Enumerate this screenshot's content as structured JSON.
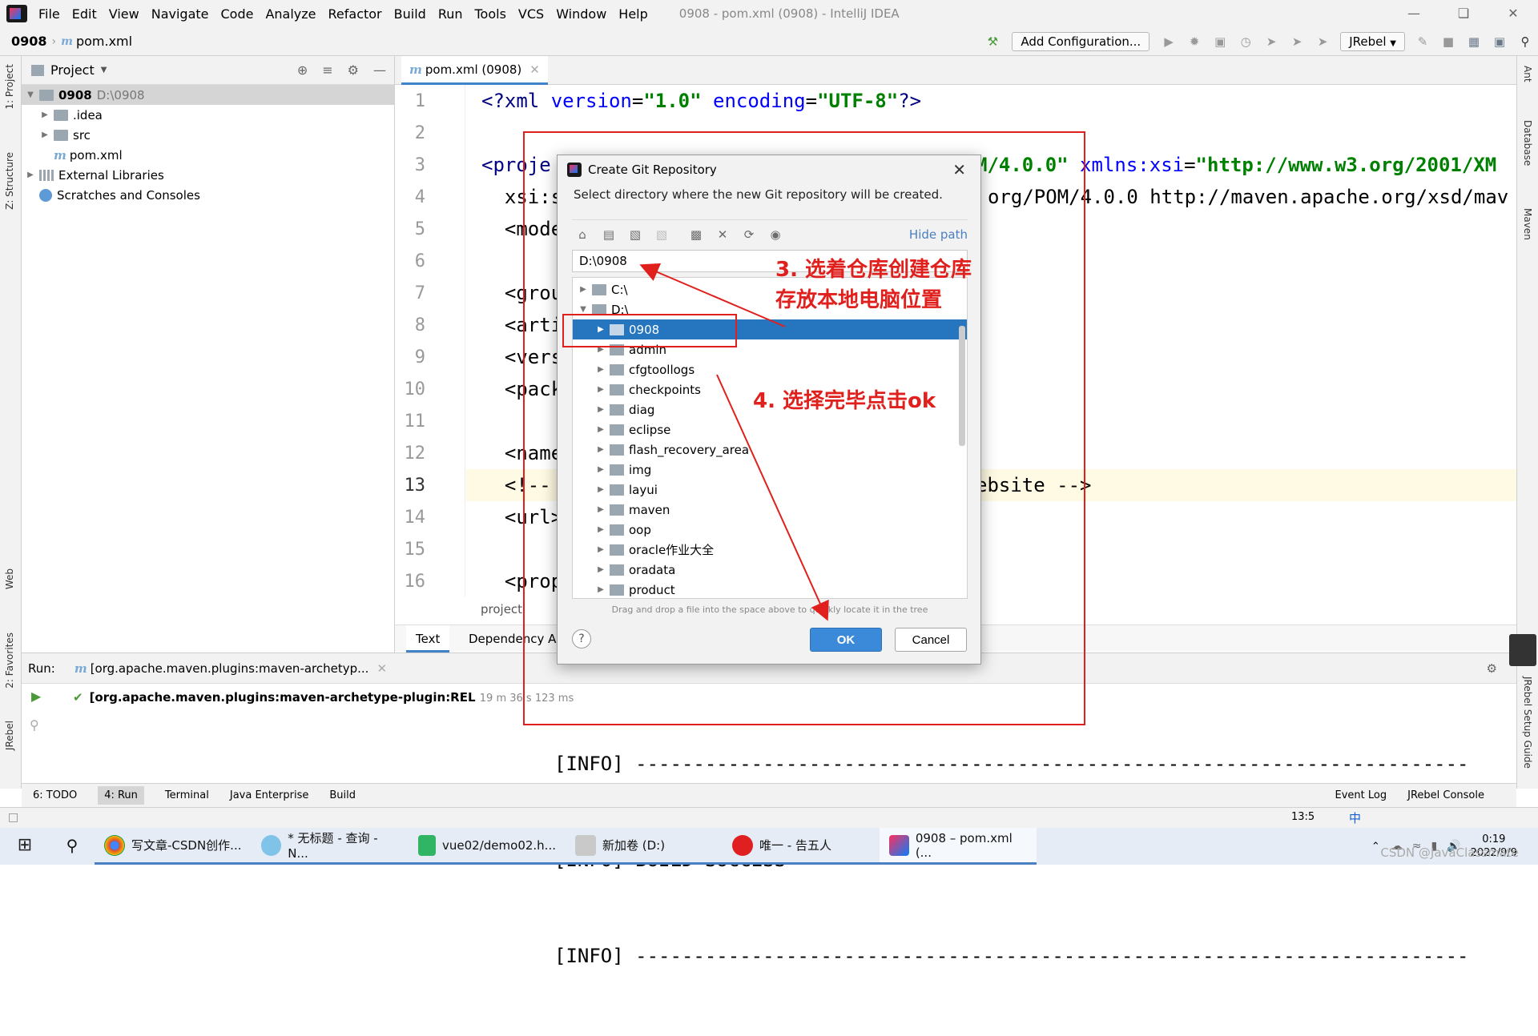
{
  "window": {
    "title": "0908 - pom.xml (0908) - IntelliJ IDEA",
    "menu": [
      "File",
      "Edit",
      "View",
      "Navigate",
      "Code",
      "Analyze",
      "Refactor",
      "Build",
      "Run",
      "Tools",
      "VCS",
      "Window",
      "Help"
    ]
  },
  "navbar": {
    "project": "0908",
    "file": "pom.xml",
    "add_configuration": "Add Configuration...",
    "jrebel": "JRebel"
  },
  "left_strip": {
    "project": "1: Project",
    "structure": "Z: Structure",
    "web": "Web",
    "favorites": "2: Favorites",
    "jrebel": "JRebel"
  },
  "right_strip": {
    "ant": "Ant",
    "database": "Database",
    "maven": "Maven",
    "jrebel_guide": "JRebel Setup Guide"
  },
  "project_panel": {
    "title": "Project",
    "root_name": "0908",
    "root_path": "D:\\0908",
    "items": [
      ".idea",
      "src",
      "pom.xml"
    ],
    "external_libraries": "External Libraries",
    "scratches": "Scratches and Consoles"
  },
  "editor": {
    "tab": "pom.xml (0908)",
    "line_numbers": [
      "1",
      "2",
      "3",
      "4",
      "5",
      "6",
      "7",
      "8",
      "9",
      "10",
      "11",
      "12",
      "13",
      "14",
      "15",
      "16"
    ],
    "bottom_tabs": [
      "Text",
      "Dependency A"
    ],
    "breadcrumb": "project",
    "code": {
      "l1_a": "<?xml ",
      "l1_b": "version",
      "l1_c": "=",
      "l1_d": "\"1.0\"",
      "l1_e": " encoding",
      "l1_f": "=",
      "l1_g": "\"UTF-8\"",
      "l1_h": "?>",
      "l3_a": "<proje",
      "l3_b": "M/4.0.0\"",
      "l3_c": " xmlns:xsi",
      "l3_d": "=",
      "l3_e": "\"http://www.w3.org/2001/XM",
      "l4_a": "  xsi:s",
      "l4_b": "org/POM/4.0.0 http://maven.apache.org/xsd/mav",
      "l5": "  <mode",
      "l7": "  <grou",
      "l8": "  <arti",
      "l9": "  <vers",
      "l10": "  <pack",
      "l12": "  <name",
      "l13_a": "  <!--",
      "l13_b": "ebsite -->",
      "l14": "  <url>",
      "l16": "  <prop"
    }
  },
  "run_panel": {
    "label": "Run:",
    "tab": "[org.apache.maven.plugins:maven-archetyp...",
    "item": "[org.apache.maven.plugins:maven-archetype-plugin:REL",
    "time": "19 m 36 s 123 ms",
    "console": [
      "[INFO] ------------------------------------------------------------------------",
      "[INFO] BUILD SUCCESS",
      "[INFO] ------------------------------------------------------------------------"
    ]
  },
  "bottom_tools": [
    "6: TODO",
    "4: Run",
    "Terminal",
    "Java Enterprise",
    "Build"
  ],
  "bottom_right_tools": [
    "Event Log",
    "JRebel Console"
  ],
  "status": {
    "position": "13:5"
  },
  "dialog": {
    "title": "Create Git Repository",
    "message": "Select directory where the new Git repository will be created.",
    "hide_path": "Hide path",
    "path": "D:\\0908",
    "tree": [
      "C:\\",
      "D:\\",
      "0908",
      "admin",
      "cfgtoollogs",
      "checkpoints",
      "diag",
      "eclipse",
      "flash_recovery_area",
      "img",
      "layui",
      "maven",
      "oop",
      "oracle作业大全",
      "oradata",
      "product"
    ],
    "hint": "Drag and drop a file into the space above to quickly locate it in the tree",
    "ok": "OK",
    "cancel": "Cancel",
    "help": "?"
  },
  "annotations": {
    "step3": "3. 选着仓库创建仓库\n存放本地电脑位置",
    "step4": "4. 选择完毕点击ok",
    "color": "#e0201d"
  },
  "taskbar": {
    "items": [
      "写文章-CSDN创作...",
      "* 无标题 - 查询 - N...",
      "vue02/demo02.h...",
      "新加卷 (D:)",
      "唯一 - 告五人",
      "0908 – pom.xml (..."
    ],
    "time": "0:19",
    "date": "2022/9/9",
    "ime": "中",
    "watermark": "CSDN @JavaClassmate"
  }
}
